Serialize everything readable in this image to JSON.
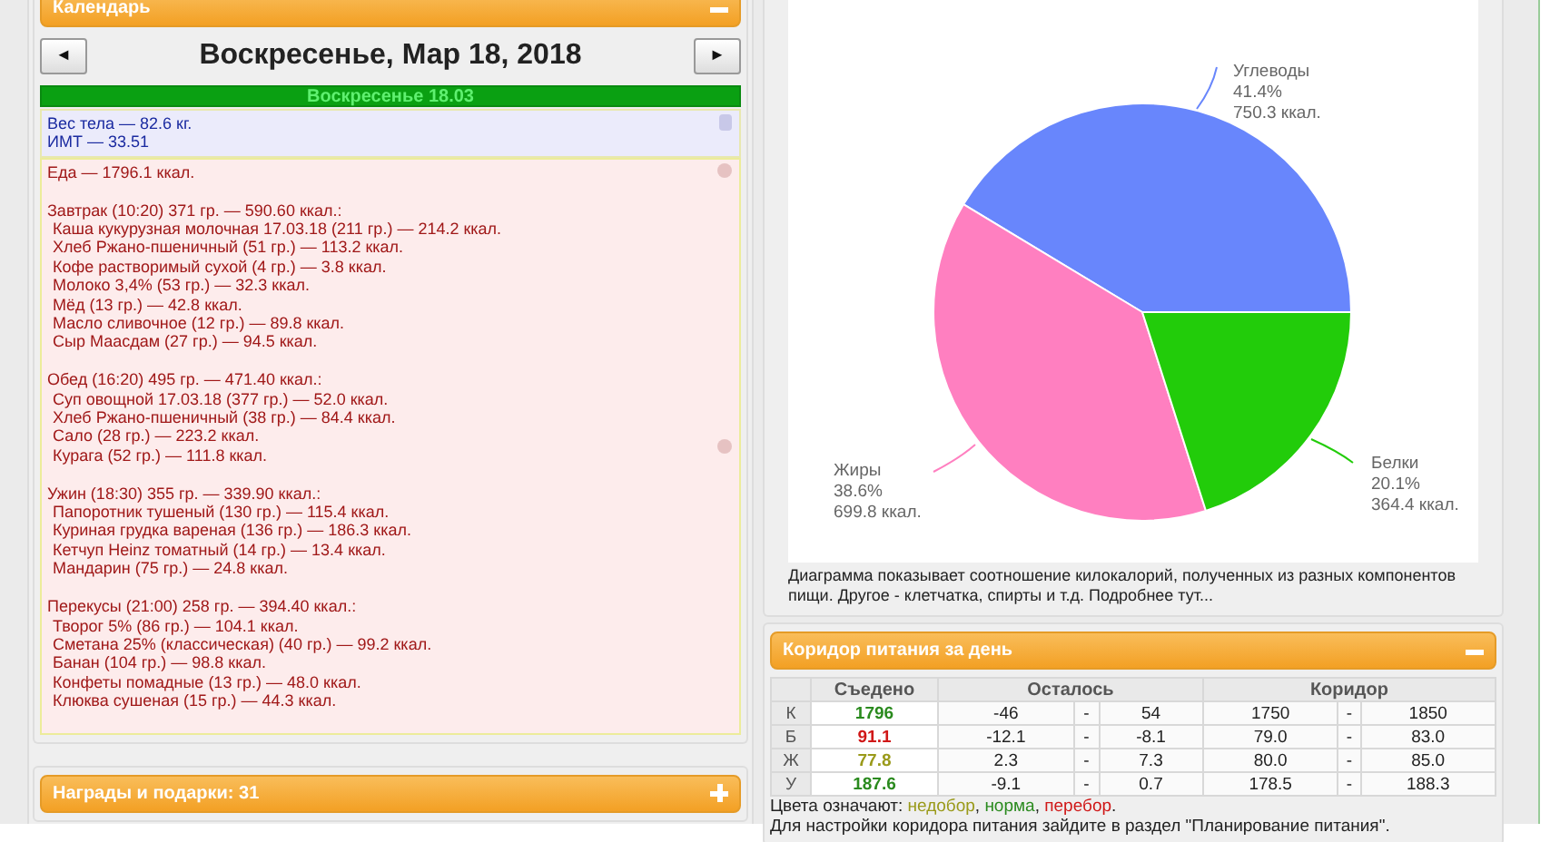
{
  "calendar": {
    "header": {
      "title": "Календарь",
      "expanded": true
    },
    "prev_button": "◄",
    "title": "Воскресенье, Мар 18, 2018",
    "next_button": "►",
    "day_bar": "Воскресенье 18.03",
    "body_lines": [
      "Вес тела — 82.6 кг.",
      "ИМТ — 33.51"
    ],
    "food_total": "Еда — 1796.1 ккал.",
    "meals": [
      {
        "title": "Завтрак (10:20) 371 гр. — 590.60 ккал.:",
        "items": [
          "Каша кукурузная молочная 17.03.18 (211 гр.) — 214.2 ккал.",
          "Хлеб Ржано-пшеничный (51 гр.) — 113.2 ккал.",
          "Кофе растворимый сухой (4 гр.) — 3.8 ккал.",
          "Молоко 3,4% (53 гр.) — 32.3 ккал.",
          "Мёд (13 гр.) — 42.8 ккал.",
          "Масло сливочное (12 гр.) — 89.8 ккал.",
          "Сыр Маасдам (27 гр.) — 94.5 ккал."
        ]
      },
      {
        "title": "Обед (16:20) 495 гр. — 471.40 ккал.:",
        "items": [
          "Суп овощной 17.03.18 (377 гр.) — 52.0 ккал.",
          "Хлеб Ржано-пшеничный (38 гр.) — 84.4 ккал.",
          "Сало (28 гр.) — 223.2 ккал.",
          "Курага (52 гр.) — 111.8 ккал."
        ]
      },
      {
        "title": "Ужин (18:30) 355 гр. — 339.90 ккал.:",
        "items": [
          "Папоротник тушеный (130 гр.) — 115.4 ккал.",
          "Куриная грудка вареная (136 гр.) — 186.3 ккал.",
          "Кетчуп Heinz томатный (14 гр.) — 13.4 ккал.",
          "Мандарин (75 гр.) — 24.8 ккал."
        ]
      },
      {
        "title": "Перекусы (21:00) 258 гр. — 394.40 ккал.:",
        "items": [
          "Творог 5% (86 гр.) — 104.1 ккал.",
          "Сметана 25% (классическая) (40 гр.) — 99.2 ккал.",
          "Банан (104 гр.) — 98.8 ккал.",
          "Конфеты помадные (13 гр.) — 48.0 ккал.",
          "Клюква сушеная (15 гр.) — 44.3 ккал."
        ]
      }
    ]
  },
  "awards": {
    "header": {
      "title": "Награды и подарки: 31",
      "expanded": false
    }
  },
  "chart_panel": {
    "chart_data": {
      "type": "pie",
      "categories": [
        "Углеводы",
        "Жиры",
        "Белки"
      ],
      "values": [
        41.4,
        38.6,
        20.1
      ]
    },
    "slices": [
      {
        "percent": "41.4%",
        "kcal": "750.3 ккал.",
        "color": "#6886fc"
      },
      {
        "percent": "38.6%",
        "kcal": "699.8 ккал.",
        "color": "#ff7fc0"
      },
      {
        "percent": "20.1%",
        "kcal": "364.4 ккал.",
        "color": "#22cc0a"
      }
    ],
    "caption": "Диаграмма показывает соотношение килокалорий, полученных из разных компонентов пищи. Другое - клетчатка, спирты и т.д. Подробнее тут..."
  },
  "corridor": {
    "header": {
      "title": "Коридор питания за день",
      "expanded": true
    },
    "columns": [
      "Съедено",
      "Осталось",
      "Коридор"
    ],
    "rows": [
      {
        "label": "К",
        "eaten": "1796",
        "color": "#2a8a1e",
        "remain": [
          "-46",
          "-",
          "54"
        ],
        "range": [
          "1750",
          "-",
          "1850"
        ]
      },
      {
        "label": "Б",
        "eaten": "91.1",
        "color": "#d01818",
        "remain": [
          "-12.1",
          "-",
          "-8.1"
        ],
        "range": [
          "79.0",
          "-",
          "83.0"
        ]
      },
      {
        "label": "Ж",
        "eaten": "77.8",
        "color": "#9a9a1a",
        "remain": [
          "2.3",
          "-",
          "7.3"
        ],
        "range": [
          "80.0",
          "-",
          "85.0"
        ]
      },
      {
        "label": "У",
        "eaten": "187.6",
        "color": "#2a8a1e",
        "remain": [
          "-9.1",
          "-",
          "0.7"
        ],
        "range": [
          "178.5",
          "-",
          "188.3"
        ]
      }
    ],
    "legend": [
      {
        "text": "Цвета означают: "
      },
      {
        "text": "недобор",
        "color": "#9a9a1a"
      },
      {
        "text": ", "
      },
      {
        "text": "норма",
        "color": "#2a8a1e"
      },
      {
        "text": ", "
      },
      {
        "text": "перебор",
        "color": "#d01818"
      },
      {
        "text": "."
      }
    ],
    "note": "Для настройки коридора питания зайдите в раздел \"Планирование питания\"."
  }
}
